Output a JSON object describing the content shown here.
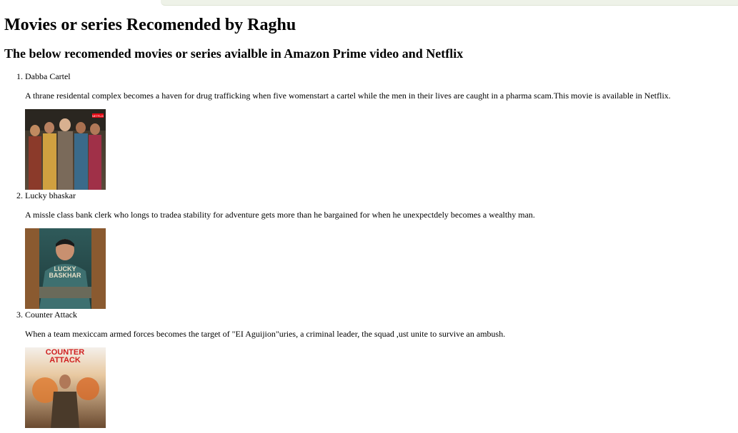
{
  "page": {
    "title": "Movies or series Recomended by Raghu",
    "subtitle": "The below recomended movies or series avialble in Amazon Prime video and Netflix"
  },
  "movies": [
    {
      "title": "Dabba Cartel",
      "description": "A thrane residental complex becomes a haven for drug trafficking when five womenstart a cartel while the men in their lives are caught in a pharma scam.This movie is available in Netflix.",
      "poster_text": "NETFLIX"
    },
    {
      "title": "Lucky bhaskar",
      "description": "A missle class bank clerk who longs to tradea stability for adventure gets more than he bargained for when he unexpectdely becomes a wealthy man.",
      "poster_text_line1": "LUCKY",
      "poster_text_line2": "BASKHAR"
    },
    {
      "title": "Counter Attack",
      "description": "When a team mexiccam armed forces becomes the target of \"EI Aguijion\"uries, a criminal leader, the squad ,ust unite to survive an ambush.",
      "poster_text_line1": "COUNTER",
      "poster_text_line2": "ATTACK"
    }
  ]
}
